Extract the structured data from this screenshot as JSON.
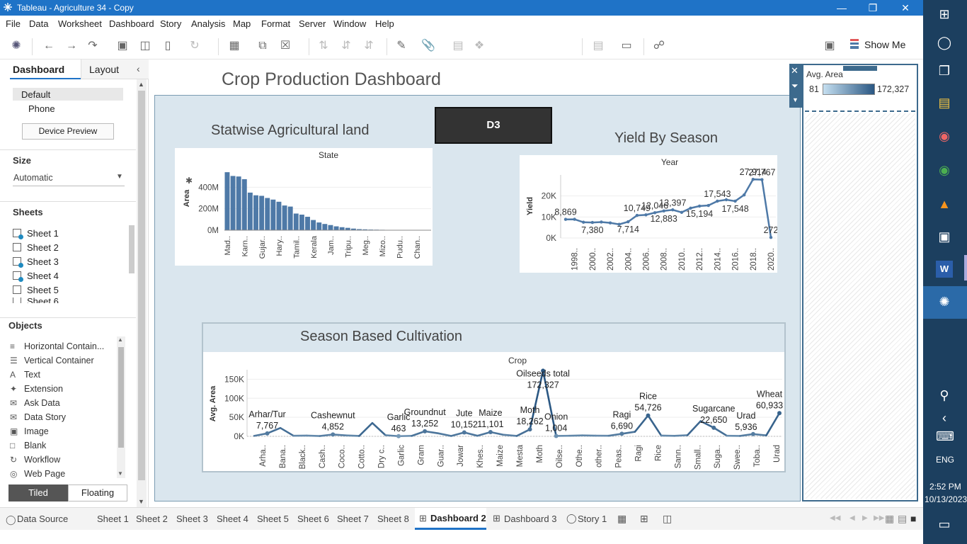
{
  "window": {
    "title": "Tableau - Agriculture 34 - Copy"
  },
  "menu": [
    "File",
    "Data",
    "Worksheet",
    "Dashboard",
    "Story",
    "Analysis",
    "Map",
    "Format",
    "Server",
    "Window",
    "Help"
  ],
  "toolbar": {
    "show_me": "Show Me"
  },
  "left": {
    "tab_dashboard": "Dashboard",
    "tab_layout": "Layout",
    "device_default": "Default",
    "device_phone": "Phone",
    "device_preview": "Device Preview",
    "size_label": "Size",
    "size_value": "Automatic",
    "sheets_label": "Sheets",
    "sheets": [
      "Sheet 1",
      "Sheet 2",
      "Sheet 3",
      "Sheet 4",
      "Sheet 5",
      "Sheet 6"
    ],
    "objects_label": "Objects",
    "objects": [
      {
        "label": "Horizontal Contain...",
        "icon": "horizontal-container-icon"
      },
      {
        "label": "Vertical Container",
        "icon": "vertical-container-icon"
      },
      {
        "label": "Text",
        "icon": "text-icon"
      },
      {
        "label": "Extension",
        "icon": "extension-icon"
      },
      {
        "label": "Ask Data",
        "icon": "ask-data-icon"
      },
      {
        "label": "Data Story",
        "icon": "data-story-icon"
      },
      {
        "label": "Image",
        "icon": "image-icon"
      },
      {
        "label": "Blank",
        "icon": "blank-icon"
      },
      {
        "label": "Workflow",
        "icon": "workflow-icon"
      },
      {
        "label": "Web Page",
        "icon": "web-page-icon"
      }
    ],
    "tiled": "Tiled",
    "floating": "Floating"
  },
  "dashboard": {
    "title": "Crop Production Dashboard",
    "d3": "D3",
    "chart1_title": "Statwise Agricultural land",
    "chart2_title": "Yield By Season",
    "chart3_title": "Season Based Cultivation"
  },
  "legend": {
    "title": "Avg. Area",
    "min": "81",
    "max": "172,327"
  },
  "chart_data": [
    {
      "type": "bar",
      "header": "State",
      "ylabel": "Area",
      "yticks": [
        "400M",
        "200M",
        "0M"
      ],
      "ylim": [
        0,
        600
      ],
      "values": [
        540,
        505,
        500,
        475,
        350,
        325,
        320,
        300,
        285,
        265,
        230,
        220,
        155,
        145,
        125,
        95,
        72,
        58,
        48,
        36,
        28,
        22,
        15,
        10,
        8,
        6,
        5,
        4,
        3,
        3,
        2,
        2,
        2,
        1,
        1,
        1
      ],
      "tick_labels": [
        "Mad..",
        "Karn..",
        "Gujar..",
        "Hary..",
        "Tamil..",
        "Kerala",
        "Jam..",
        "Tripu..",
        "Meg..",
        "Mizo..",
        "Pudu..",
        "Chan.."
      ],
      "color": "#4e79a7"
    },
    {
      "type": "line",
      "header": "Year",
      "ylabel": "Yield",
      "yticks": [
        "20K",
        "10K",
        "0K"
      ],
      "ylim": [
        0,
        30000
      ],
      "x": [
        1997,
        1998,
        1999,
        2000,
        2001,
        2002,
        2003,
        2004,
        2005,
        2006,
        2007,
        2008,
        2009,
        2010,
        2011,
        2012,
        2013,
        2014,
        2015,
        2016,
        2017,
        2018,
        2019,
        2020
      ],
      "values": [
        8869,
        8900,
        7500,
        7380,
        7600,
        7200,
        6500,
        7714,
        10749,
        11000,
        12046,
        12883,
        13397,
        12200,
        14200,
        15194,
        15500,
        17543,
        18200,
        17548,
        20500,
        27914,
        27767,
        272
      ],
      "labels": [
        {
          "i": 0,
          "text": "8,869"
        },
        {
          "i": 3,
          "text": "7,380"
        },
        {
          "i": 7,
          "text": "7,714"
        },
        {
          "i": 8,
          "text": "10,749"
        },
        {
          "i": 10,
          "text": "12,046"
        },
        {
          "i": 11,
          "text": "12,883"
        },
        {
          "i": 12,
          "text": "13,397"
        },
        {
          "i": 15,
          "text": "15,194"
        },
        {
          "i": 17,
          "text": "17,543"
        },
        {
          "i": 19,
          "text": "17,548"
        },
        {
          "i": 21,
          "text": "27,914"
        },
        {
          "i": 22,
          "text": "27,767"
        },
        {
          "i": 23,
          "text": "272"
        }
      ],
      "tick_labels": [
        "1998..",
        "2000..",
        "2002..",
        "2004..",
        "2006..",
        "2008..",
        "2010..",
        "2012..",
        "2014..",
        "2016..",
        "2018..",
        "2020.."
      ],
      "color": "#4e79a7"
    },
    {
      "type": "line",
      "header": "Crop",
      "ylabel": "Avg. Area",
      "yticks": [
        "150K",
        "100K",
        "50K",
        "0K"
      ],
      "ylim": [
        0,
        175000
      ],
      "values": [
        1200,
        7767,
        22000,
        1500,
        2000,
        800,
        4852,
        2500,
        1000,
        35000,
        3000,
        463,
        1200,
        13252,
        8000,
        1000,
        10152,
        1500,
        11101,
        4000,
        1000,
        18262,
        172327,
        1004,
        1500,
        2500,
        1800,
        1500,
        6690,
        12000,
        54726,
        2000,
        1200,
        3000,
        40000,
        22650,
        1500,
        1000,
        5936,
        2500,
        60933
      ],
      "labels": [
        {
          "i": 1,
          "name": "Arhar/Tur",
          "value": "7,767"
        },
        {
          "i": 6,
          "name": "Cashewnut",
          "value": "4,852"
        },
        {
          "i": 11,
          "name": "Garlic",
          "value": "463"
        },
        {
          "i": 13,
          "name": "Groundnut",
          "value": "13,252"
        },
        {
          "i": 16,
          "name": "Jute",
          "value": "10,152"
        },
        {
          "i": 18,
          "name": "Maize",
          "value": "11,101"
        },
        {
          "i": 21,
          "name": "Moth",
          "value": "18,262"
        },
        {
          "i": 22,
          "name": "Oilseeds total",
          "value": "172,327"
        },
        {
          "i": 23,
          "name": "Onion",
          "value": "1,004"
        },
        {
          "i": 28,
          "name": "Ragi",
          "value": "6,690"
        },
        {
          "i": 30,
          "name": "Rice",
          "value": "54,726"
        },
        {
          "i": 35,
          "name": "Sugarcane",
          "value": "22,650"
        },
        {
          "i": 38,
          "name": "Urad",
          "value": "5,936"
        },
        {
          "i": 40,
          "name": "Wheat",
          "value": "60,933"
        }
      ],
      "tick_labels": [
        "Arha..",
        "Bana..",
        "Black..",
        "Cash..",
        "Coco..",
        "Cotto..",
        "Dry c..",
        "Garlic",
        "Gram",
        "Guar..",
        "Jowar",
        "Khes..",
        "Maize",
        "Mesta",
        "Moth",
        "Oilse..",
        "Othe..",
        "other..",
        "Peas..",
        "Ragi",
        "Rice",
        "Sann..",
        "Small..",
        "Suga..",
        "Swee..",
        "Toba..",
        "Urad"
      ]
    }
  ],
  "bottom_tabs": [
    "Data Source",
    "Sheet 1",
    "Sheet 2",
    "Sheet 3",
    "Sheet 4",
    "Sheet 5",
    "Sheet 6",
    "Sheet 7",
    "Sheet 8",
    "Dashboard 2",
    "Dashboard 3",
    "Story 1"
  ],
  "taskbar": {
    "lang": "ENG",
    "time": "2:52 PM",
    "date": "10/13/2023"
  }
}
